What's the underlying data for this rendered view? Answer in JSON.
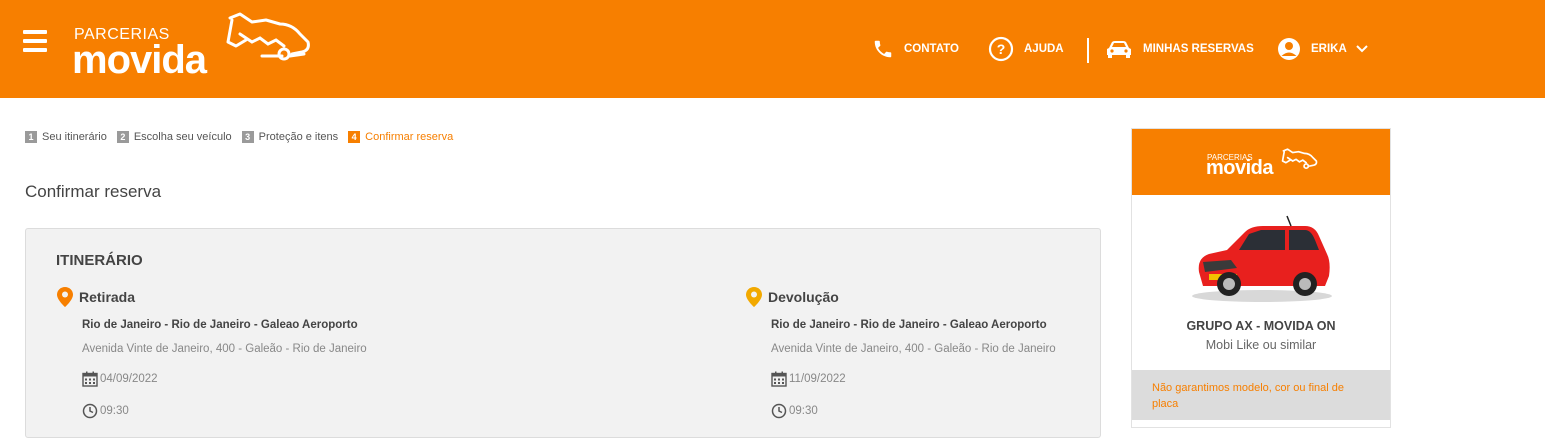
{
  "header": {
    "logo_small": "PARCERIAS",
    "logo_big": "movida",
    "nav": {
      "contato": "CONTATO",
      "ajuda": "AJUDA",
      "reservas": "MINHAS RESERVAS",
      "user": "ERIKA"
    }
  },
  "steps": [
    {
      "num": "1",
      "label": "Seu itinerário"
    },
    {
      "num": "2",
      "label": "Escolha seu veículo"
    },
    {
      "num": "3",
      "label": "Proteção e itens"
    },
    {
      "num": "4",
      "label": "Confirmar reserva"
    }
  ],
  "page_title": "Confirmar reserva",
  "itinerary": {
    "title": "ITINERÁRIO",
    "pickup": {
      "label": "Retirada",
      "name": "Rio de Janeiro - Rio de Janeiro - Galeao Aeroporto",
      "address": "Avenida Vinte de Janeiro, 400 - Galeão - Rio de Janeiro",
      "date": "04/09/2022",
      "time": "09:30"
    },
    "return": {
      "label": "Devolução",
      "name": "Rio de Janeiro - Rio de Janeiro - Galeao Aeroporto",
      "address": "Avenida Vinte de Janeiro, 400 - Galeão - Rio de Janeiro",
      "date": "11/09/2022",
      "time": "09:30"
    }
  },
  "sidebar": {
    "logo_small": "PARCERIAS",
    "logo_big": "movida",
    "group": "GRUPO AX - MOVIDA ON",
    "model": "Mobi Like ou similar",
    "warning": "Não garantimos modelo, cor ou final de placa"
  },
  "colors": {
    "brand": "#f77f00",
    "pickup_pin": "#f77f00",
    "return_pin": "#f2a900"
  }
}
